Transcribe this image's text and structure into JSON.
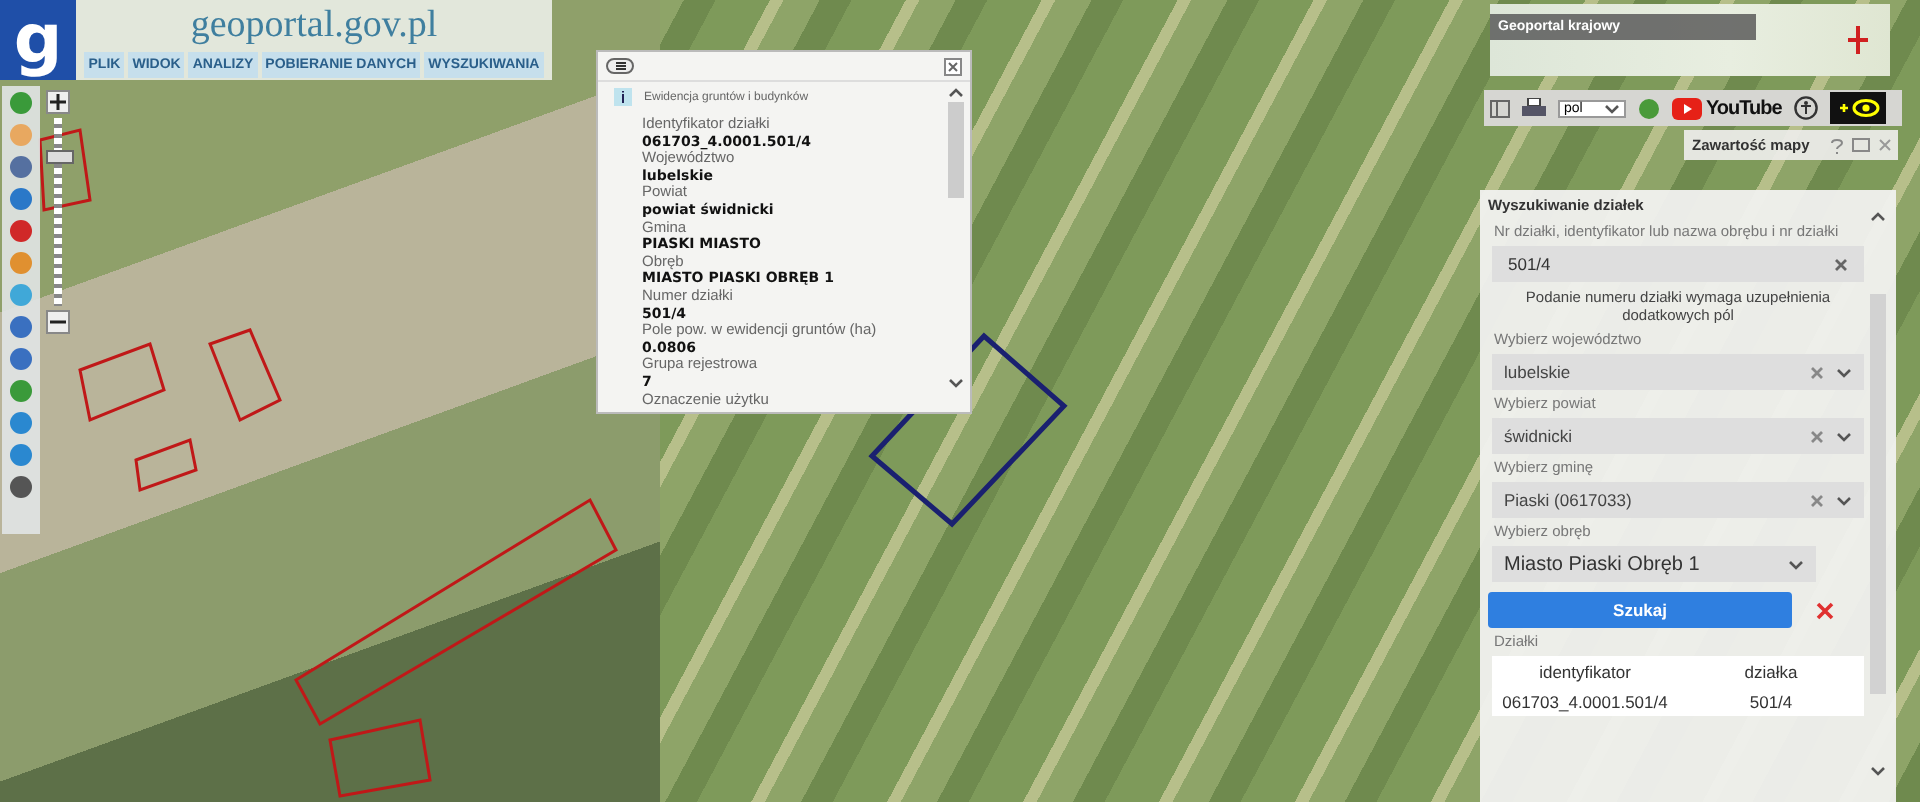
{
  "logo": {
    "letter": "g"
  },
  "site_title": "geoportal.gov.pl",
  "menu": [
    {
      "label": "PLIK"
    },
    {
      "label": "WIDOK"
    },
    {
      "label": "ANALIZY"
    },
    {
      "label": "POBIERANIE DANYCH"
    },
    {
      "label": "WYSZUKIWANIA"
    }
  ],
  "zoom": {
    "level": 0.8
  },
  "info_popup": {
    "title": "Ewidencja gruntów i budynków",
    "fields": [
      {
        "label": "Identyfikator działki",
        "value": "061703_4.0001.501/4"
      },
      {
        "label": "Województwo",
        "value": "lubelskie"
      },
      {
        "label": "Powiat",
        "value": "powiat świdnicki"
      },
      {
        "label": "Gmina",
        "value": "PIASKI MIASTO"
      },
      {
        "label": "Obręb",
        "value": "MIASTO PIASKI OBRĘB 1"
      },
      {
        "label": "Numer działki",
        "value": "501/4"
      },
      {
        "label": "Pole pow. w ewidencji gruntów (ha)",
        "value": "0.0806"
      },
      {
        "label": "Grupa rejestrowa",
        "value": "7"
      },
      {
        "label": "Oznaczenie użytku"
      }
    ]
  },
  "minimap": {
    "title": "Geoportal krajowy"
  },
  "toolbar": {
    "language": "pol",
    "video_label": "YouTube"
  },
  "map_contents": {
    "title": "Zawartość mapy"
  },
  "parcel_search": {
    "title": "Wyszukiwanie działek",
    "query_label": "Nr działki, identyfikator lub nazwa obrębu i nr działki",
    "query_value": "501/4",
    "hint": "Podanie numeru działki wymaga uzupełnienia dodatkowych pól",
    "selects": [
      {
        "label": "Wybierz województwo",
        "value": "lubelskie",
        "clearable": true
      },
      {
        "label": "Wybierz powiat",
        "value": "świdnicki",
        "clearable": true
      },
      {
        "label": "Wybierz gminę",
        "value": "Piaski (0617033)",
        "clearable": true
      },
      {
        "label": "Wybierz obręb",
        "value": "Miasto Piaski Obręb 1",
        "clearable": false
      }
    ],
    "search_button": "Szukaj",
    "results": {
      "title": "Działki",
      "columns": [
        "identyfikator",
        "działka"
      ],
      "rows": [
        [
          "061703_4.0001.501/4",
          "501/4"
        ]
      ]
    }
  }
}
